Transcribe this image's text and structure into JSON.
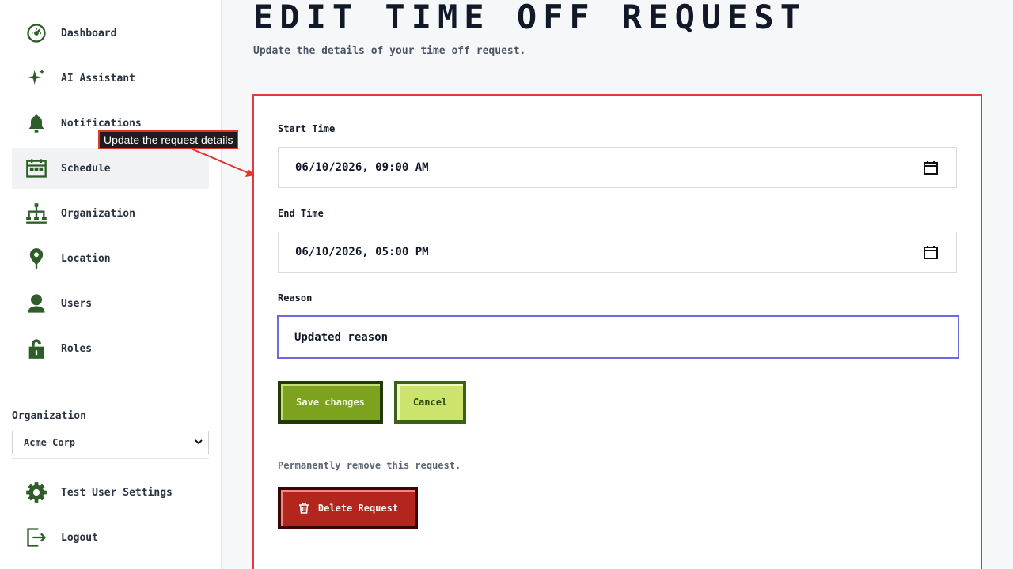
{
  "sidebar": {
    "items": [
      {
        "label": "Dashboard",
        "icon": "dashboard-icon"
      },
      {
        "label": "AI Assistant",
        "icon": "sparkle-icon"
      },
      {
        "label": "Notifications",
        "icon": "bell-icon"
      },
      {
        "label": "Schedule",
        "icon": "calendar-icon",
        "active": true
      },
      {
        "label": "Organization",
        "icon": "org-chart-icon"
      },
      {
        "label": "Location",
        "icon": "map-pin-icon"
      },
      {
        "label": "Users",
        "icon": "user-icon"
      },
      {
        "label": "Roles",
        "icon": "unlock-icon"
      }
    ],
    "org_label": "Organization",
    "org_selected": "Acme Corp",
    "settings_label": "Test User Settings",
    "logout_label": "Logout"
  },
  "tooltip": "Update the request details",
  "page": {
    "title": "EDIT TIME OFF REQUEST",
    "subtitle": "Update the details of your time off request."
  },
  "form": {
    "start_label": "Start Time",
    "start_value": "06/10/2026, 09:00 AM",
    "end_label": "End Time",
    "end_value": "06/10/2026, 05:00 PM",
    "reason_label": "Reason",
    "reason_value": "Updated reason",
    "save_label": "Save changes",
    "cancel_label": "Cancel",
    "danger_text": "Permanently remove this request.",
    "delete_label": "Delete Request"
  },
  "colors": {
    "icon_green": "#2f5d2a",
    "highlight_red": "#e03a3a",
    "focus_blue": "#6b6bdf",
    "save_green": "#7da21e",
    "cancel_green": "#cce46b",
    "delete_red": "#b3261e"
  }
}
